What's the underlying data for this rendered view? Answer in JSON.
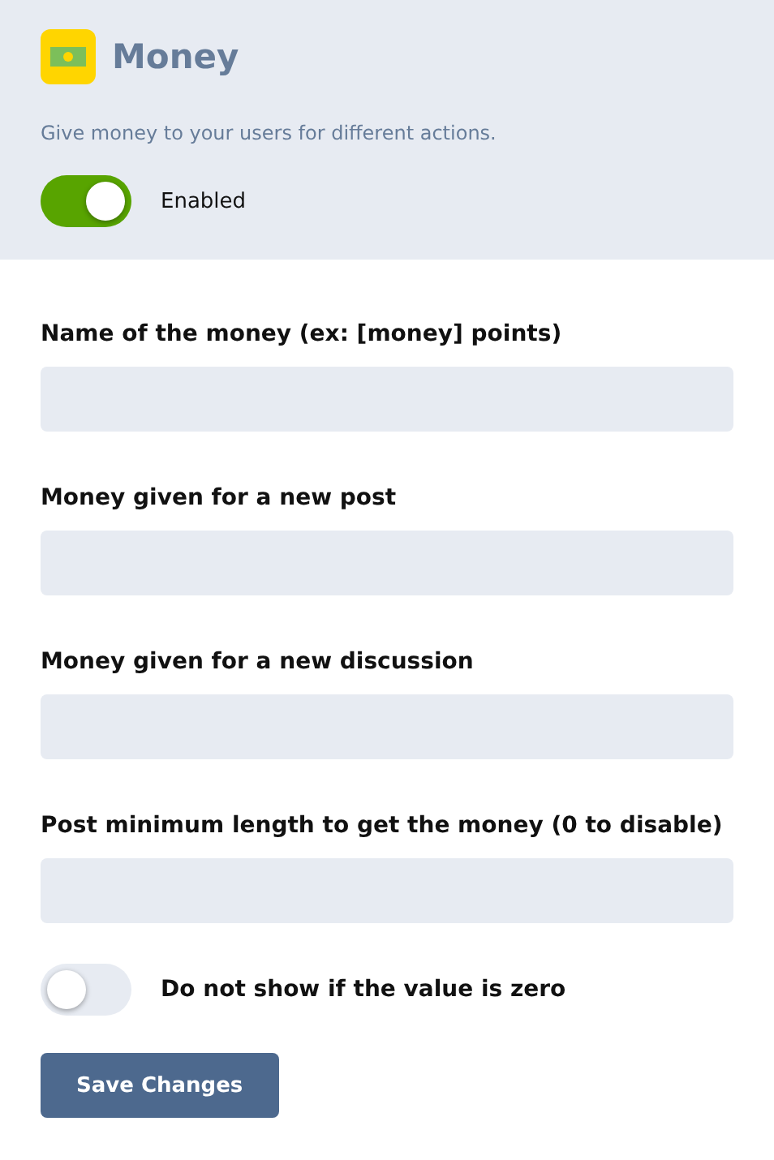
{
  "header": {
    "title": "Money",
    "description": "Give money to your users for different actions.",
    "toggle": {
      "label": "Enabled",
      "on": true
    }
  },
  "fields": [
    {
      "label": "Name of the money (ex: [money] points)"
    },
    {
      "label": "Money given for a new post"
    },
    {
      "label": "Money given for a new discussion"
    },
    {
      "label": "Post minimum length to get the money (0 to disable)"
    }
  ],
  "options": [
    {
      "label": "Do not show if the value is zero",
      "on": false
    }
  ],
  "button": "Save Changes"
}
